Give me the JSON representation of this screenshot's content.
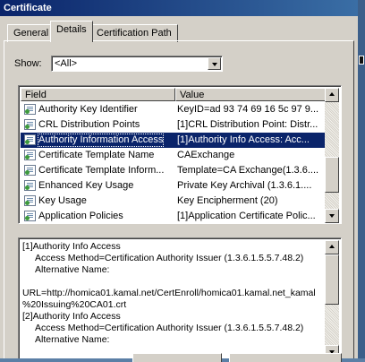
{
  "window": {
    "title": "Certificate"
  },
  "tabs": [
    {
      "label": "General",
      "active": false
    },
    {
      "label": "Details",
      "active": true
    },
    {
      "label": "Certification Path",
      "active": false
    }
  ],
  "show": {
    "label": "Show:",
    "selected": "<All>"
  },
  "list": {
    "columns": [
      "Field",
      "Value"
    ],
    "rows": [
      {
        "field": "Authority Key Identifier",
        "value": "KeyID=ad 93 74 69 16 5c 97 9...",
        "selected": false
      },
      {
        "field": "CRL Distribution Points",
        "value": "[1]CRL Distribution Point: Distr...",
        "selected": false
      },
      {
        "field": "Authority Information Access",
        "value": "[1]Authority Info Access: Acc...",
        "selected": true
      },
      {
        "field": "Certificate Template Name",
        "value": "CAExchange",
        "selected": false
      },
      {
        "field": "Certificate Template Inform...",
        "value": "Template=CA Exchange(1.3.6....",
        "selected": false
      },
      {
        "field": "Enhanced Key Usage",
        "value": "Private Key Archival (1.3.6.1....",
        "selected": false
      },
      {
        "field": "Key Usage",
        "value": "Key Encipherment (20)",
        "selected": false
      },
      {
        "field": "Application Policies",
        "value": "[1]Application Certificate Polic...",
        "selected": false
      }
    ]
  },
  "details": {
    "lines": [
      "[1]Authority Info Access",
      "     Access Method=Certification Authority Issuer (1.3.6.1.5.5.7.48.2)",
      "     Alternative Name:",
      "",
      "URL=http://homica01.kamal.net/CertEnroll/homica01.kamal.net_kamal",
      "%20Issuing%20CA01.crt",
      "[2]Authority Info Access",
      "     Access Method=Certification Authority Issuer (1.3.6.1.5.5.7.48.2)",
      "     Alternative Name:"
    ]
  },
  "colors": {
    "titlebar": "#0a246a",
    "selection": "#0a246a",
    "dialog_face": "#d4d0c8"
  }
}
